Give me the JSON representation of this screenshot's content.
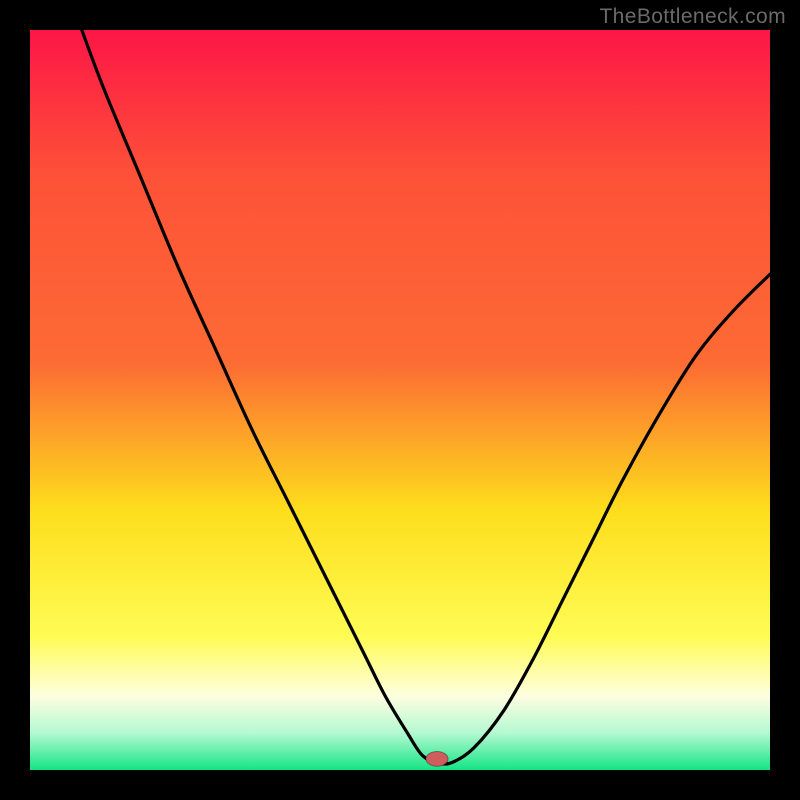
{
  "watermark": "TheBottleneck.com",
  "colors": {
    "gradient_top": "#fd1646",
    "gradient_mid1": "#fd6b34",
    "gradient_mid2": "#fdde1c",
    "gradient_mid3": "#fffc55",
    "gradient_low1": "#fefee0",
    "gradient_low2": "#b4f9d2",
    "gradient_bottom": "#14e585",
    "curve": "#000000",
    "marker": "#cf5d5d",
    "frame": "#000000"
  },
  "chart_data": {
    "type": "line",
    "title": "",
    "xlabel": "",
    "ylabel": "",
    "xlim": [
      0,
      100
    ],
    "ylim": [
      0,
      100
    ],
    "description": "V-shaped bottleneck curve; minimum near x≈55, y≈0; open top on both branches",
    "marker": {
      "x": 55,
      "y": 1.5,
      "rx": 1.5,
      "ry": 1.0
    },
    "series": [
      {
        "name": "bottleneck-curve",
        "x": [
          7,
          10,
          15,
          20,
          25,
          30,
          35,
          40,
          45,
          48,
          51,
          53,
          55,
          57,
          60,
          64,
          68,
          72,
          76,
          80,
          85,
          90,
          95,
          100
        ],
        "y": [
          100,
          92,
          80,
          68,
          57,
          46,
          36,
          26,
          16,
          10,
          5,
          2,
          1,
          1,
          3,
          8,
          15,
          23,
          31,
          39,
          48,
          56,
          62,
          67
        ]
      }
    ]
  }
}
